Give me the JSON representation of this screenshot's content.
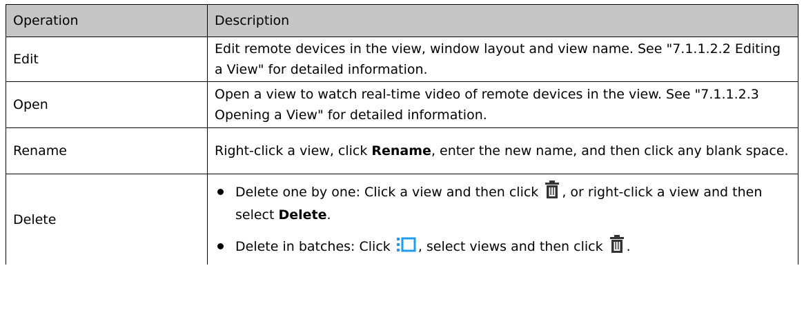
{
  "table": {
    "headers": {
      "operation": "Operation",
      "description": "Description"
    },
    "rows": [
      {
        "operation": "Edit",
        "description": "Edit remote devices in the view, window layout and view name. See \"7.1.1.2.2 Editing a View\" for detailed information."
      },
      {
        "operation": "Open",
        "description": "Open a view to watch real-time video of remote devices in the view. See \"7.1.1.2.3 Opening a View\" for detailed information."
      },
      {
        "operation": "Rename",
        "description_parts": [
          "Right-click a view, click ",
          "Rename",
          ", enter the new name, and then click any blank space."
        ]
      },
      {
        "operation": "Delete",
        "bullets": [
          {
            "before_icon": "Delete one by one: Click a view and then click ",
            "icon": "trash-icon",
            "after_icon": ", or right-click a view and then select ",
            "bold": "Delete",
            "end": "."
          },
          {
            "before_icon": "Delete in batches: Click ",
            "icon1": "batch-select-icon",
            "middle": ", select views and then click ",
            "icon2": "trash-icon",
            "end": "."
          }
        ]
      }
    ]
  },
  "colors": {
    "header_bg": "#c6c6c6",
    "border": "#000000",
    "batch_icon": "#1e9cf0"
  }
}
